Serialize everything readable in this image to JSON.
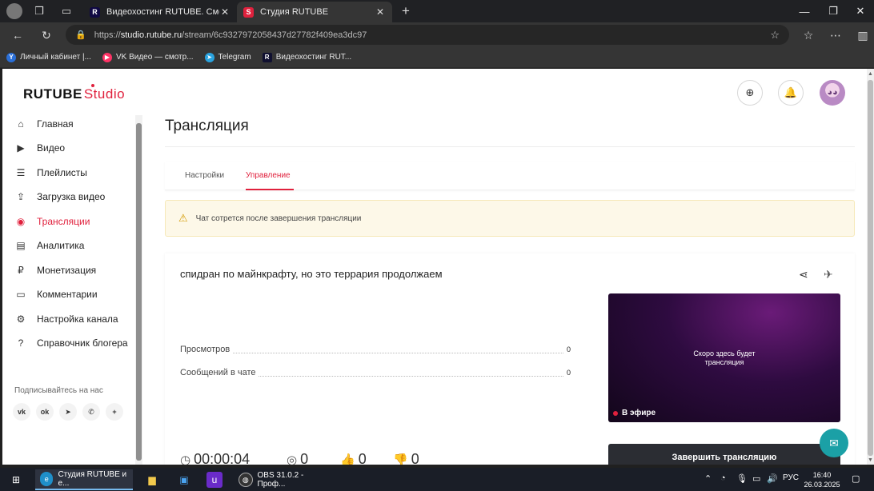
{
  "browser": {
    "tabs": [
      {
        "title": "Видеохостинг RUTUBE. Смотрите",
        "icon": "rutube-favicon"
      },
      {
        "title": "Студия RUTUBE",
        "icon": "rutube-studio-favicon"
      }
    ],
    "new_tab": "+",
    "address": {
      "scheme": "https://",
      "host": "studio.rutube.ru",
      "path": "/stream/6c9327972058437d27782f409ea3dc97"
    },
    "bookmarks": [
      {
        "label": "Личный кабинет |...",
        "icon": "yandex-icon",
        "color": "#2a6fd8"
      },
      {
        "label": "VK Видео — смотр...",
        "icon": "vk-video-icon",
        "color": "#ff3366"
      },
      {
        "label": "Telegram",
        "icon": "telegram-icon",
        "color": "#2aa3df"
      },
      {
        "label": "Видеохостинг RUT...",
        "icon": "rutube-icon",
        "color": "#101030"
      }
    ]
  },
  "page": {
    "logo_main": "RUTUBE",
    "logo_studio": "Studio",
    "accent_color": "#e0213d",
    "sidebar": {
      "items": [
        {
          "label": "Главная",
          "icon": "home-icon"
        },
        {
          "label": "Видео",
          "icon": "video-icon"
        },
        {
          "label": "Плейлисты",
          "icon": "playlist-icon"
        },
        {
          "label": "Загрузка видео",
          "icon": "upload-icon"
        },
        {
          "label": "Трансляции",
          "icon": "broadcast-icon",
          "active": true
        },
        {
          "label": "Аналитика",
          "icon": "analytics-icon"
        },
        {
          "label": "Монетизация",
          "icon": "monetization-icon"
        },
        {
          "label": "Комментарии",
          "icon": "comments-icon"
        },
        {
          "label": "Настройка канала",
          "icon": "settings-icon"
        },
        {
          "label": "Справочник блогера",
          "icon": "help-icon"
        }
      ],
      "subscribe_label": "Подписывайтесь на нас",
      "social": [
        "vk-icon",
        "ok-icon",
        "telegram-icon",
        "viber-icon",
        "more-icon"
      ]
    },
    "title": "Трансляция",
    "tabs": [
      "Настройки",
      "Управление"
    ],
    "active_tab": "Управление",
    "warning": "Чат сотрется после завершения трансляции",
    "stream": {
      "title": "спидран по майнкрафту, но это террария продолжаем",
      "stats": [
        {
          "label": "Просмотров",
          "value": "0"
        },
        {
          "label": "Сообщений в чате",
          "value": "0"
        }
      ],
      "preview_line1": "Скоро здесь будет",
      "preview_line2": "трансляция",
      "live_badge": "В эфире",
      "end_button": "Завершить трансляцию",
      "bottom": {
        "duration": "00:00:04",
        "viewers": "0",
        "likes": "0",
        "dislikes": "0"
      }
    }
  },
  "taskbar": {
    "apps": [
      {
        "label": "Студия RUTUBE и е...",
        "icon": "edge-icon"
      },
      {
        "label": "OBS 31.0.2 - Проф...",
        "icon": "obs-icon"
      }
    ],
    "language": "РУС",
    "time": "16:40",
    "date": "26.03.2025"
  }
}
